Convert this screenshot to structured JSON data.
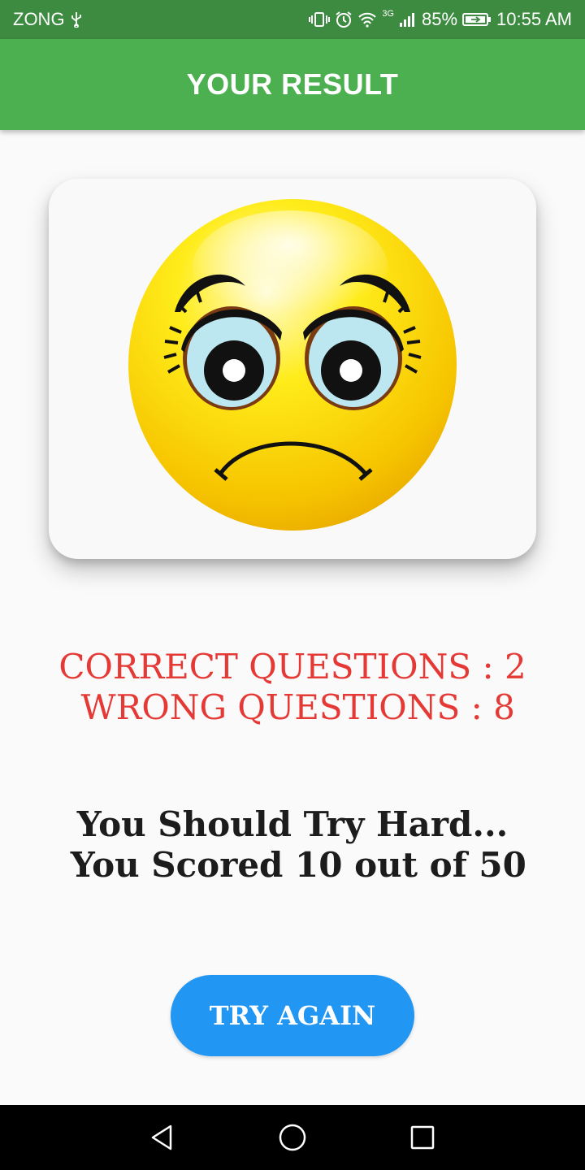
{
  "status_bar": {
    "carrier": "ZONG",
    "network": "3G",
    "battery": "85%",
    "time": "10:55 AM"
  },
  "app_bar": {
    "title": "YOUR RESULT"
  },
  "result": {
    "correct_line": "CORRECT QUESTIONS : 2",
    "wrong_line": " WRONG QUESTIONS : 8"
  },
  "message": {
    "line1": "You Should Try Hard...",
    "line2": " You Scored 10 out of 50"
  },
  "try_again_label": "TRY AGAIN",
  "colors": {
    "status_bar": "#3d8b40",
    "app_bar": "#4caf50",
    "result_text": "#e53935",
    "button": "#2196f3"
  },
  "icons": {
    "result_image": "sad-face-emoji-icon",
    "nav": [
      "back-icon",
      "home-icon",
      "recents-icon"
    ]
  }
}
